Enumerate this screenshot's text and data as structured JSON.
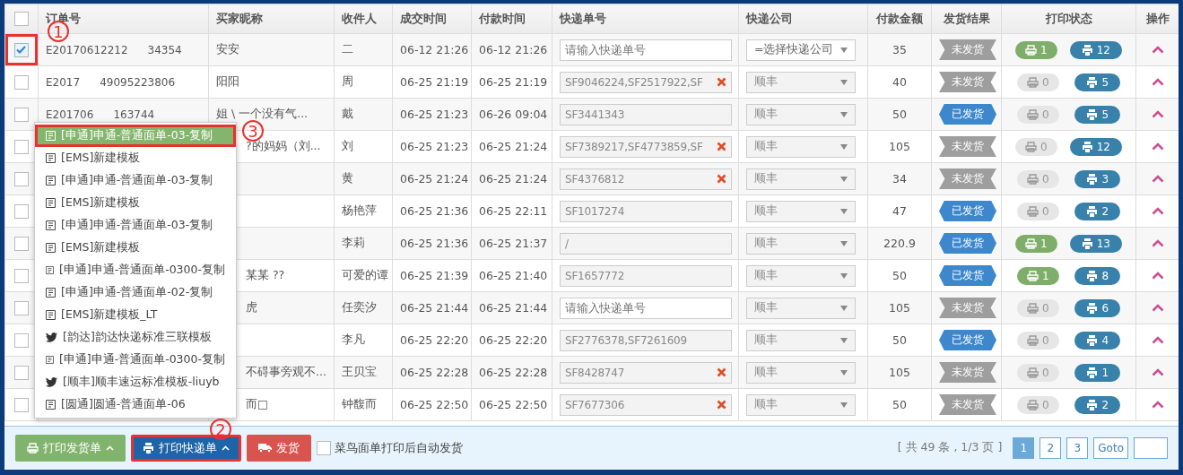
{
  "table": {
    "select_all": {
      "checked": false
    },
    "columns": [
      "订单号",
      "买家昵称",
      "收件人",
      "成交时间",
      "付款时间",
      "快递单号",
      "快递公司",
      "付款金额",
      "发货结果",
      "打印状态",
      "操作"
    ],
    "rows": [
      {
        "checked": true,
        "order": {
          "start": "E20170612212",
          "end": "34354"
        },
        "buyer": "安安",
        "buyer_covered": false,
        "recipient": "二",
        "deal_time": "06-12 21:26",
        "pay_time": "06-12 21:26",
        "tracking": {
          "placeholder": "请输入快递单号",
          "editable": true,
          "error": false
        },
        "courier": {
          "value": "=选择快递公司",
          "editable": true
        },
        "amount": "35",
        "shipped": false,
        "result": "未发货",
        "invoice_prints": {
          "count": "1",
          "printed": true
        },
        "express_prints": "12"
      },
      {
        "checked": false,
        "order": {
          "start": "E2017",
          "end": "49095223806"
        },
        "buyer": "阳阳",
        "buyer_covered": false,
        "recipient": "周",
        "deal_time": "06-25 21:19",
        "pay_time": "06-25 21:19",
        "tracking": {
          "value": "SF9046224,SF2517922,SF",
          "editable": false,
          "error": true
        },
        "courier": {
          "value": "顺丰",
          "editable": false
        },
        "amount": "40",
        "shipped": false,
        "result": "未发货",
        "invoice_prints": {
          "count": "0",
          "printed": false
        },
        "express_prints": "5"
      },
      {
        "checked": false,
        "order": {
          "start": "E201706",
          "end": "163744"
        },
        "buyer": "姐 \\ 一个没有气...",
        "buyer_covered": false,
        "recipient": "戴",
        "deal_time": "06-25 21:23",
        "pay_time": "06-26 09:04",
        "tracking": {
          "value": "SF3441343",
          "editable": false,
          "error": false
        },
        "courier": {
          "value": "顺丰",
          "editable": false
        },
        "amount": "50",
        "shipped": true,
        "result": "已发货",
        "invoice_prints": {
          "count": "0",
          "printed": false
        },
        "express_prints": "5"
      },
      {
        "checked": false,
        "buyer": "?的妈妈（刘...",
        "buyer_covered": true,
        "recipient": "刘",
        "deal_time": "06-25 21:23",
        "pay_time": "06-25 21:24",
        "tracking": {
          "value": "SF7389217,SF4773859,SF",
          "editable": false,
          "error": true
        },
        "courier": {
          "value": "顺丰",
          "editable": false
        },
        "amount": "105",
        "shipped": false,
        "result": "未发货",
        "invoice_prints": {
          "count": "0",
          "printed": false
        },
        "express_prints": "12"
      },
      {
        "checked": false,
        "recipient": "黄",
        "deal_time": "06-25 21:24",
        "pay_time": "06-25 21:24",
        "tracking": {
          "value": "SF4376812",
          "editable": false,
          "error": true
        },
        "courier": {
          "value": "顺丰",
          "editable": false
        },
        "amount": "34",
        "shipped": false,
        "result": "未发货",
        "invoice_prints": {
          "count": "0",
          "printed": false
        },
        "express_prints": "3"
      },
      {
        "checked": false,
        "recipient": "杨艳萍",
        "deal_time": "06-25 21:36",
        "pay_time": "06-25 22:11",
        "tracking": {
          "value": "SF1017274",
          "editable": false,
          "error": false
        },
        "courier": {
          "value": "顺丰",
          "editable": false
        },
        "amount": "47",
        "shipped": true,
        "result": "已发货",
        "invoice_prints": {
          "count": "0",
          "printed": false
        },
        "express_prints": "2"
      },
      {
        "checked": false,
        "recipient": "李莉",
        "deal_time": "06-25 21:36",
        "pay_time": "06-25 21:37",
        "tracking": {
          "value": "/",
          "editable": false,
          "error": false
        },
        "courier": {
          "value": "顺丰",
          "editable": false
        },
        "amount": "220.9",
        "shipped": true,
        "result": "已发货",
        "invoice_prints": {
          "count": "1",
          "printed": true
        },
        "express_prints": "13"
      },
      {
        "checked": false,
        "buyer": "某某 ??",
        "buyer_covered": true,
        "recipient": "可爱的谭",
        "deal_time": "06-25 21:39",
        "pay_time": "06-25 21:40",
        "tracking": {
          "value": "SF1657772",
          "editable": false,
          "error": false
        },
        "courier": {
          "value": "顺丰",
          "editable": false
        },
        "amount": "50",
        "shipped": true,
        "result": "已发货",
        "invoice_prints": {
          "count": "1",
          "printed": true
        },
        "express_prints": "8"
      },
      {
        "checked": false,
        "buyer": "虎",
        "buyer_covered": true,
        "recipient": "任奕汐",
        "deal_time": "06-25 21:44",
        "pay_time": "06-25 21:44",
        "tracking": {
          "placeholder": "请输入快递单号",
          "editable": true,
          "error": false
        },
        "courier": {
          "value": "顺丰",
          "editable": false
        },
        "amount": "105",
        "shipped": false,
        "result": "未发货",
        "invoice_prints": {
          "count": "0",
          "printed": false
        },
        "express_prints": "6"
      },
      {
        "checked": false,
        "recipient": "李凡",
        "deal_time": "06-25 22:20",
        "pay_time": "06-25 22:20",
        "tracking": {
          "value": "SF2776378,SF7261609",
          "editable": false,
          "error": false
        },
        "courier": {
          "value": "顺丰",
          "editable": false
        },
        "amount": "50",
        "shipped": true,
        "result": "已发货",
        "invoice_prints": {
          "count": "0",
          "printed": false
        },
        "express_prints": "4"
      },
      {
        "checked": false,
        "buyer": "不碍事旁观不...",
        "buyer_covered": true,
        "recipient": "王贝宝",
        "deal_time": "06-25 22:28",
        "pay_time": "06-25 22:28",
        "tracking": {
          "value": "SF8428747",
          "editable": false,
          "error": true
        },
        "courier": {
          "value": "顺丰",
          "editable": false
        },
        "amount": "105",
        "shipped": false,
        "result": "未发货",
        "invoice_prints": {
          "count": "0",
          "printed": false
        },
        "express_prints": "1"
      },
      {
        "checked": false,
        "buyer": "而□",
        "buyer_covered": true,
        "recipient": "钟馥而",
        "deal_time": "06-25 22:50",
        "pay_time": "06-25 22:50",
        "tracking": {
          "value": "SF7677306",
          "editable": false,
          "error": true
        },
        "courier": {
          "value": "顺丰",
          "editable": false
        },
        "amount": "50",
        "shipped": false,
        "result": "未发货",
        "invoice_prints": {
          "count": "0",
          "printed": false
        },
        "express_prints": "2"
      }
    ]
  },
  "template_menu": {
    "items": [
      {
        "label": "[申通]申通-普通面单-03-复制",
        "kind": "template",
        "selected": true
      },
      {
        "label": "[EMS]新建模板",
        "kind": "template",
        "selected": false
      },
      {
        "label": "[申通]申通-普通面单-03-复制",
        "kind": "template",
        "selected": false
      },
      {
        "label": "[EMS]新建模板",
        "kind": "template",
        "selected": false
      },
      {
        "label": "[申通]申通-普通面单-03-复制",
        "kind": "template",
        "selected": false
      },
      {
        "label": "[EMS]新建模板",
        "kind": "template",
        "selected": false
      },
      {
        "label": "[申通]申通-普通面单-0300-复制",
        "kind": "template",
        "selected": false
      },
      {
        "label": "[申通]申通-普通面单-02-复制",
        "kind": "template",
        "selected": false
      },
      {
        "label": "[EMS]新建模板_LT",
        "kind": "template",
        "selected": false
      },
      {
        "label": "[韵达]韵达快递标准三联模板",
        "kind": "bird",
        "selected": false
      },
      {
        "label": "[申通]申通-普通面单-0300-复制",
        "kind": "template",
        "selected": false
      },
      {
        "label": "[顺丰]顺丰速运标准模板-liuyb",
        "kind": "bird",
        "selected": false
      },
      {
        "label": "[圆通]圆通-普通面单-06",
        "kind": "template",
        "selected": false
      }
    ]
  },
  "annotations": [
    "1",
    "3",
    "2"
  ],
  "footer": {
    "buttons": [
      {
        "label": "打印发货单",
        "kind": "invoice",
        "highlighted": false
      },
      {
        "label": "打印快递单",
        "kind": "express",
        "highlighted": true
      },
      {
        "label": "发货",
        "kind": "ship",
        "highlighted": false
      }
    ],
    "auto_ship": {
      "label": "菜鸟面单打印后自动发货",
      "checked": false
    },
    "summary": "[ 共 49 条 , 1/3 页 ]",
    "pages": [
      {
        "label": "1",
        "selected": true
      },
      {
        "label": "2",
        "selected": false
      },
      {
        "label": "3",
        "selected": false
      }
    ],
    "goto": "Goto"
  }
}
